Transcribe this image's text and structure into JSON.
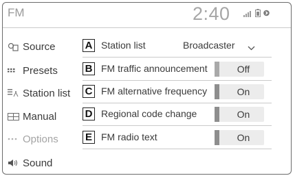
{
  "header": {
    "title": "FM",
    "clock": "2:40",
    "status_icons": [
      "signal-icon",
      "battery-icon",
      "bluetooth-icon"
    ]
  },
  "sidebar": {
    "items": [
      {
        "label": "Source",
        "icon": "source-icon",
        "enabled": true
      },
      {
        "label": "Presets",
        "icon": "presets-icon",
        "enabled": true
      },
      {
        "label": "Station list",
        "icon": "station-list-icon",
        "enabled": true
      },
      {
        "label": "Manual",
        "icon": "manual-icon",
        "enabled": true
      },
      {
        "label": "Options",
        "icon": "options-icon",
        "enabled": false
      },
      {
        "label": "Sound",
        "icon": "speaker-icon",
        "enabled": true
      }
    ]
  },
  "settings": {
    "rows": [
      {
        "letter": "A",
        "label": "Station list",
        "value": "Broadcaster",
        "control": "dropdown"
      },
      {
        "letter": "B",
        "label": "FM traffic announcement",
        "value": "Off",
        "control": "toggle"
      },
      {
        "letter": "C",
        "label": "FM alternative frequency",
        "value": "On",
        "control": "toggle"
      },
      {
        "letter": "D",
        "label": "Regional code change",
        "value": "On",
        "control": "toggle"
      },
      {
        "letter": "E",
        "label": "FM radio text",
        "value": "On",
        "control": "toggle"
      }
    ]
  },
  "colors": {
    "text": "#3a3a3a",
    "muted": "#a4a4a4",
    "toggle_bg": "#ececec",
    "toggle_on_bar": "#8e8e8e"
  }
}
